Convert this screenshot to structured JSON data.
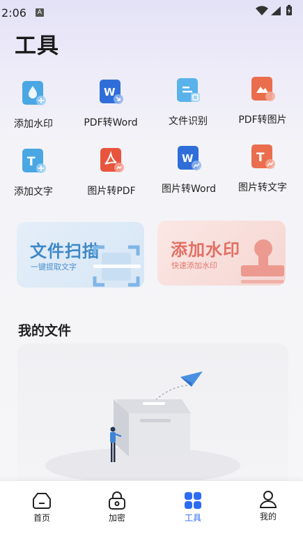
{
  "status_bar": {
    "time": "2:06",
    "notification_letter": "A"
  },
  "page_title": "工具",
  "tools": [
    {
      "label": "添加水印",
      "icon": "watermark-drop-icon",
      "color": "#4aa7e4"
    },
    {
      "label": "PDF转Word",
      "icon": "word-doc-icon",
      "color": "#2f6ed8"
    },
    {
      "label": "文件识别",
      "icon": "scan-file-icon",
      "color": "#4aa7e4"
    },
    {
      "label": "PDF转图片",
      "icon": "image-file-icon",
      "color": "#ea6d4d"
    },
    {
      "label": "添加文字",
      "icon": "text-add-icon",
      "color": "#4aa7e4"
    },
    {
      "label": "图片转PDF",
      "icon": "pdf-acrobat-icon",
      "color": "#e8543d"
    },
    {
      "label": "图片转Word",
      "icon": "word-image-icon",
      "color": "#2f6ed8"
    },
    {
      "label": "图片转文字",
      "icon": "text-image-icon",
      "color": "#ea6d4d"
    }
  ],
  "banners": {
    "scan": {
      "title": "文件扫描",
      "subtitle": "一键提取文字",
      "color": "#3e88c7"
    },
    "watermark": {
      "title": "添加水印",
      "subtitle": "快速添加水印",
      "color": "#e26f63"
    }
  },
  "my_files": {
    "title": "我的文件"
  },
  "bottom_nav": {
    "items": [
      {
        "label": "首页",
        "icon": "home-icon",
        "active": false
      },
      {
        "label": "加密",
        "icon": "lock-icon",
        "active": false
      },
      {
        "label": "工具",
        "icon": "tools-grid-icon",
        "active": true
      },
      {
        "label": "我的",
        "icon": "profile-icon",
        "active": false
      }
    ],
    "active_color": "#2b6cf3"
  }
}
